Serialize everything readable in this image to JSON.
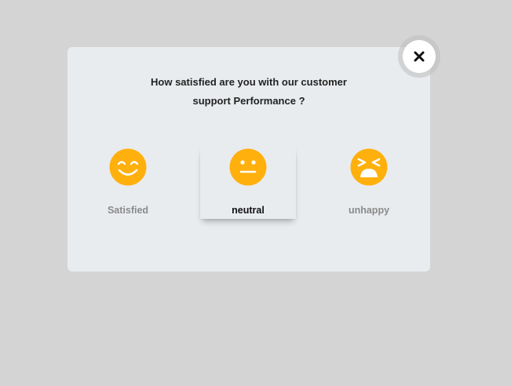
{
  "survey": {
    "question_line1": "How satisfied are you with our customer",
    "question_line2": "support Performance ?",
    "options": [
      {
        "label": "Satisfied",
        "icon": "smiling-face-icon",
        "selected": false
      },
      {
        "label": "neutral",
        "icon": "neutral-face-icon",
        "selected": true
      },
      {
        "label": "unhappy",
        "icon": "tired-face-icon",
        "selected": false
      }
    ]
  },
  "close": {
    "icon": "close-icon"
  },
  "colors": {
    "background": "#d4d4d4",
    "modal": "#e9ecef",
    "emoji": "#ffb00d",
    "emoji_features": "#ffffff",
    "label_muted": "#8a8a8a",
    "label_active": "#111111"
  }
}
